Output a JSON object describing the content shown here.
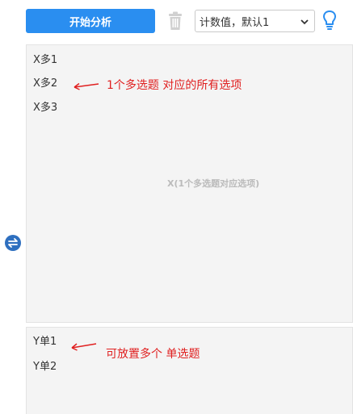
{
  "toolbar": {
    "start_label": "开始分析",
    "count_select": {
      "value": "计数值，默认1"
    }
  },
  "x_panel": {
    "items": [
      "X多1",
      "X多2",
      "X多3"
    ],
    "placeholder": "X(1个多选题对应选项)",
    "annotation": "1个多选题 对应的所有选项"
  },
  "y_panel": {
    "items": [
      "Y单1",
      "Y单2"
    ],
    "annotation": "可放置多个 单选题"
  },
  "colors": {
    "accent": "#2a8ef0",
    "annotation": "#e02020",
    "swap_icon": "#2e6fbf"
  },
  "icons": [
    "trash-icon",
    "chevron-down-icon",
    "lightbulb-icon",
    "swap-icon",
    "arrow-icon"
  ]
}
